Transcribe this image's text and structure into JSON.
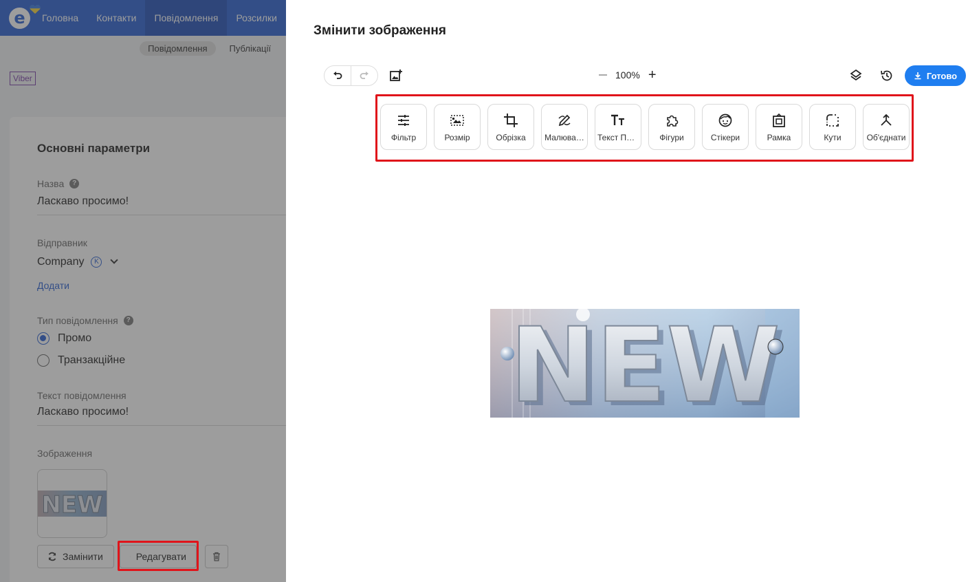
{
  "nav": {
    "items": [
      {
        "label": "Головна",
        "active": false
      },
      {
        "label": "Контакти",
        "active": false
      },
      {
        "label": "Повідомлення",
        "active": true
      },
      {
        "label": "Розсилки",
        "active": false
      }
    ]
  },
  "subnav": {
    "tabs": [
      {
        "label": "Повідомлення",
        "active": true
      },
      {
        "label": "Публікації",
        "active": false
      }
    ]
  },
  "channel_tag": "Viber",
  "form": {
    "section_title": "Основні параметри",
    "name_label": "Назва",
    "name_value": "Ласкаво просимо!",
    "sender_label": "Відправник",
    "sender_value": "Company",
    "sender_badge": "K",
    "add_link": "Додати",
    "type_label": "Тип повідомлення",
    "type_options": [
      {
        "label": "Промо",
        "selected": true
      },
      {
        "label": "Транзакційне",
        "selected": false
      }
    ],
    "text_label": "Текст повідомлення",
    "text_value": "Ласкаво просимо!",
    "image_label": "Зображення",
    "replace_button": "Замінити",
    "edit_button": "Редагувати"
  },
  "editor": {
    "title": "Змінити зображення",
    "zoom": "100%",
    "done_button": "Готово",
    "tools": [
      {
        "label": "Фільтр",
        "icon": "filter-icon"
      },
      {
        "label": "Розмір",
        "icon": "resize-icon"
      },
      {
        "label": "Обрізка",
        "icon": "crop-icon"
      },
      {
        "label": "Малюва…",
        "icon": "draw-icon"
      },
      {
        "label": "Текст По…",
        "icon": "text-icon"
      },
      {
        "label": "Фігури",
        "icon": "shapes-icon"
      },
      {
        "label": "Стікери",
        "icon": "stickers-icon"
      },
      {
        "label": "Рамка",
        "icon": "frame-icon"
      },
      {
        "label": "Кути",
        "icon": "corners-icon"
      },
      {
        "label": "Об'єднати",
        "icon": "merge-icon"
      }
    ],
    "image_text": "NEW"
  },
  "colors": {
    "brand": "#2b61d2",
    "done": "#1f7ef0",
    "highlight": "#e0141a"
  }
}
